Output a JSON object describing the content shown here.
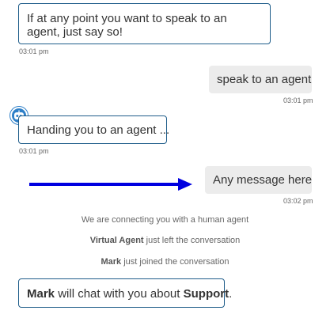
{
  "messages": {
    "m1": {
      "text": "If at any point you want to speak to an agent, just say so!",
      "time": "03:01 pm"
    },
    "m2": {
      "text": "speak to an agent",
      "time": "03:01 pm"
    },
    "m3": {
      "text": "Handing you to an agent ...",
      "time": "03:01 pm"
    },
    "m4": {
      "text": "Any message here",
      "time": "03:02 pm"
    }
  },
  "system": {
    "connecting": "We are connecting you with a human agent",
    "left_name": "Virtual Agent",
    "left_text": " just left the conversation",
    "joined_name": "Mark",
    "joined_text": " just joined the conversation"
  },
  "final": {
    "agent_name": "Mark",
    "text_before_topic": " will chat with you about ",
    "topic": "Support",
    "text_end": "."
  },
  "colors": {
    "bot_border": "#1f5d8a",
    "user_bubble": "#ececec",
    "arrow": "#0000e0",
    "avatar": "#2f80c8"
  },
  "icons": {
    "avatar": "robot-avatar-icon",
    "annotation": "arrow-right-icon"
  }
}
